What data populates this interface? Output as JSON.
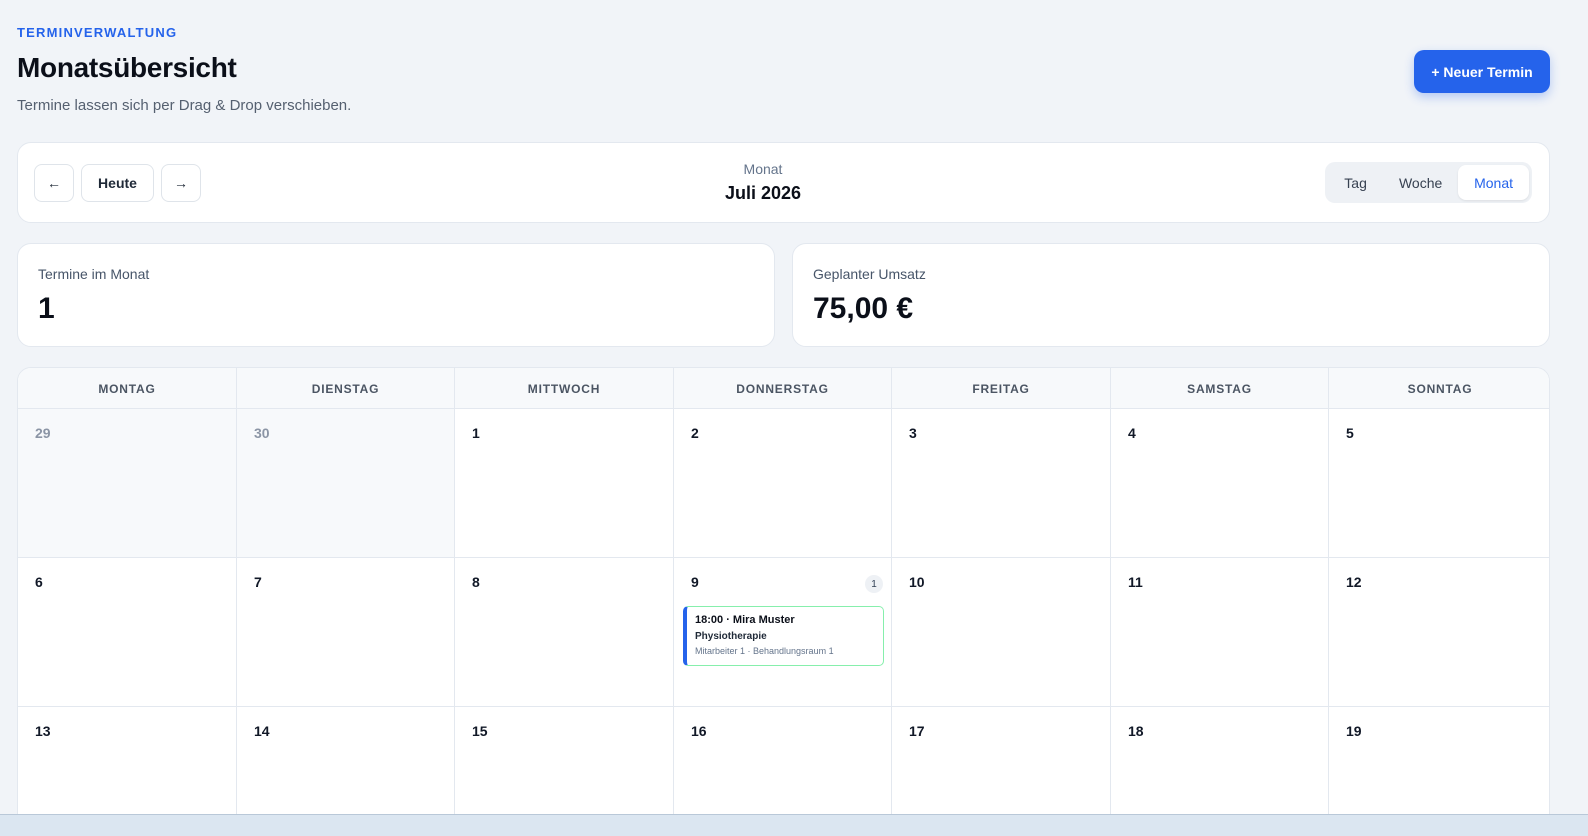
{
  "header": {
    "eyebrow": "TERMINVERWALTUNG",
    "title": "Monatsübersicht",
    "subtitle": "Termine lassen sich per Drag & Drop verschieben.",
    "new_button": "+ Neuer Termin"
  },
  "toolbar": {
    "prev_icon": "←",
    "today_label": "Heute",
    "next_icon": "→",
    "period_label": "Monat",
    "period_value": "Juli 2026",
    "views": [
      "Tag",
      "Woche",
      "Monat"
    ],
    "active_view": "Monat"
  },
  "stats": [
    {
      "label": "Termine im Monat",
      "value": "1"
    },
    {
      "label": "Geplanter Umsatz",
      "value": "75,00 €"
    }
  ],
  "calendar": {
    "weekdays": [
      "MONTAG",
      "DIENSTAG",
      "MITTWOCH",
      "DONNERSTAG",
      "FREITAG",
      "SAMSTAG",
      "SONNTAG"
    ],
    "weeks": [
      [
        {
          "day": "29",
          "muted": true
        },
        {
          "day": "30",
          "muted": true
        },
        {
          "day": "1"
        },
        {
          "day": "2"
        },
        {
          "day": "3"
        },
        {
          "day": "4"
        },
        {
          "day": "5"
        }
      ],
      [
        {
          "day": "6"
        },
        {
          "day": "7"
        },
        {
          "day": "8"
        },
        {
          "day": "9",
          "badge": "1",
          "event": {
            "title": "18:00 · Mira Muster",
            "service": "Physiotherapie",
            "meta": "Mitarbeiter 1 · Behandlungsraum 1"
          }
        },
        {
          "day": "10"
        },
        {
          "day": "11"
        },
        {
          "day": "12"
        }
      ],
      [
        {
          "day": "13"
        },
        {
          "day": "14"
        },
        {
          "day": "15"
        },
        {
          "day": "16"
        },
        {
          "day": "17"
        },
        {
          "day": "18"
        },
        {
          "day": "19"
        }
      ]
    ]
  },
  "colors": {
    "accent": "#2563eb",
    "event_border": "#86efac",
    "background": "#f1f4f8"
  }
}
